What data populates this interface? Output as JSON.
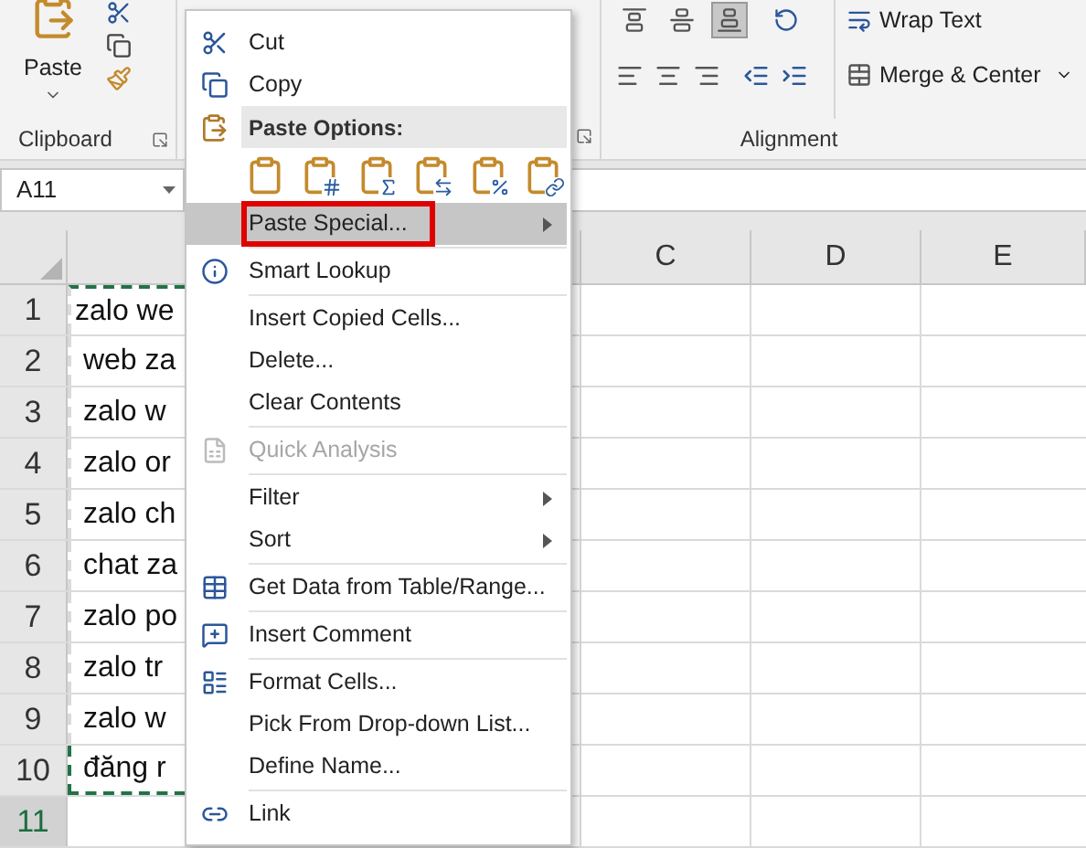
{
  "ribbon": {
    "clipboard": {
      "paste_label": "Paste",
      "group_label": "Clipboard"
    },
    "alignment": {
      "vertical_buttons": [
        {
          "selected": false
        },
        {
          "selected": false
        },
        {
          "selected": true
        }
      ],
      "wrap_text": "Wrap Text",
      "merge": "Merge & Center",
      "group_label": "Alignment"
    }
  },
  "name_box": "A11",
  "columns": [
    {
      "label": "C"
    },
    {
      "label": "D"
    },
    {
      "label": "E"
    }
  ],
  "rows": [
    {
      "header": "1",
      "cell": "zalo we",
      "selected": false,
      "in_copy_range": true
    },
    {
      "header": "2",
      "cell": " web za",
      "selected": false,
      "in_copy_range": true
    },
    {
      "header": "3",
      "cell": " zalo w",
      "selected": false,
      "in_copy_range": true
    },
    {
      "header": "4",
      "cell": " zalo or",
      "selected": false,
      "in_copy_range": true
    },
    {
      "header": "5",
      "cell": " zalo ch",
      "selected": false,
      "in_copy_range": true
    },
    {
      "header": "6",
      "cell": " chat za",
      "selected": false,
      "in_copy_range": true
    },
    {
      "header": "7",
      "cell": " zalo po",
      "selected": false,
      "in_copy_range": true
    },
    {
      "header": "8",
      "cell": " zalo tr",
      "selected": false,
      "in_copy_range": true
    },
    {
      "header": "9",
      "cell": " zalo w",
      "selected": false,
      "in_copy_range": true
    },
    {
      "header": "10",
      "cell": " đăng r",
      "selected": false,
      "in_copy_range": true
    },
    {
      "header": "11",
      "selected": true,
      "in_copy_range": false
    }
  ],
  "context_menu": [
    {
      "kind": "item",
      "label": "Cut",
      "disabled": false,
      "selected": false,
      "submenu": false
    },
    {
      "kind": "item",
      "label": "Copy",
      "disabled": false,
      "selected": false,
      "submenu": false
    },
    {
      "kind": "header",
      "label": "Paste Options:"
    },
    {
      "kind": "paste-options"
    },
    {
      "kind": "item",
      "label": "Paste Special...",
      "disabled": false,
      "selected": true,
      "submenu": true,
      "marked": true
    },
    {
      "kind": "separator"
    },
    {
      "kind": "item",
      "label": "Smart Lookup",
      "disabled": false,
      "selected": false,
      "submenu": false
    },
    {
      "kind": "separator"
    },
    {
      "kind": "item",
      "label": "Insert Copied Cells...",
      "disabled": false,
      "selected": false,
      "submenu": false
    },
    {
      "kind": "item",
      "label": "Delete...",
      "disabled": false,
      "selected": false,
      "submenu": false
    },
    {
      "kind": "item",
      "label": "Clear Contents",
      "disabled": false,
      "selected": false,
      "submenu": false
    },
    {
      "kind": "separator"
    },
    {
      "kind": "item",
      "label": "Quick Analysis",
      "disabled": true,
      "selected": false,
      "submenu": false
    },
    {
      "kind": "separator"
    },
    {
      "kind": "item",
      "label": "Filter",
      "disabled": false,
      "selected": false,
      "submenu": true
    },
    {
      "kind": "item",
      "label": "Sort",
      "disabled": false,
      "selected": false,
      "submenu": true
    },
    {
      "kind": "separator"
    },
    {
      "kind": "item",
      "label": "Get Data from Table/Range...",
      "disabled": false,
      "selected": false,
      "submenu": false
    },
    {
      "kind": "separator"
    },
    {
      "kind": "item",
      "label": "Insert Comment",
      "disabled": false,
      "selected": false,
      "submenu": false
    },
    {
      "kind": "separator"
    },
    {
      "kind": "item",
      "label": "Format Cells...",
      "disabled": false,
      "selected": false,
      "submenu": false
    },
    {
      "kind": "item",
      "label": "Pick From Drop-down List...",
      "disabled": false,
      "selected": false,
      "submenu": false
    },
    {
      "kind": "item",
      "label": "Define Name...",
      "disabled": false,
      "selected": false,
      "submenu": false
    },
    {
      "kind": "separator"
    },
    {
      "kind": "item",
      "label": "Link",
      "disabled": false,
      "selected": false,
      "submenu": false
    }
  ]
}
